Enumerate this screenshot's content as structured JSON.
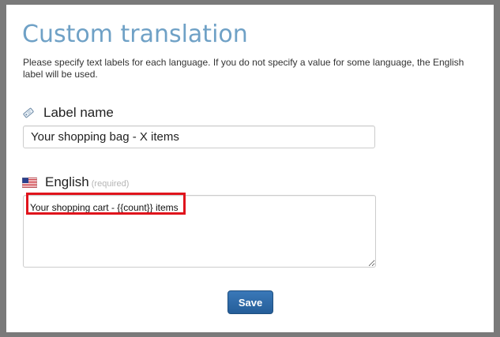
{
  "dialog": {
    "title": "Custom translation",
    "description": "Please specify text labels for each language. If you do not specify a value for some language, the English label will be used."
  },
  "label_name_field": {
    "icon": "tag-icon",
    "label": "Label name",
    "value": "Your shopping bag - X items"
  },
  "english_field": {
    "icon": "us-flag-icon",
    "label": "English",
    "required_text": "(required)",
    "value": "Your shopping cart - {{count}} items"
  },
  "actions": {
    "save_label": "Save"
  },
  "colors": {
    "title": "#6fa1c6",
    "save_button": "#2d6aa8",
    "highlight": "#e0141c"
  }
}
